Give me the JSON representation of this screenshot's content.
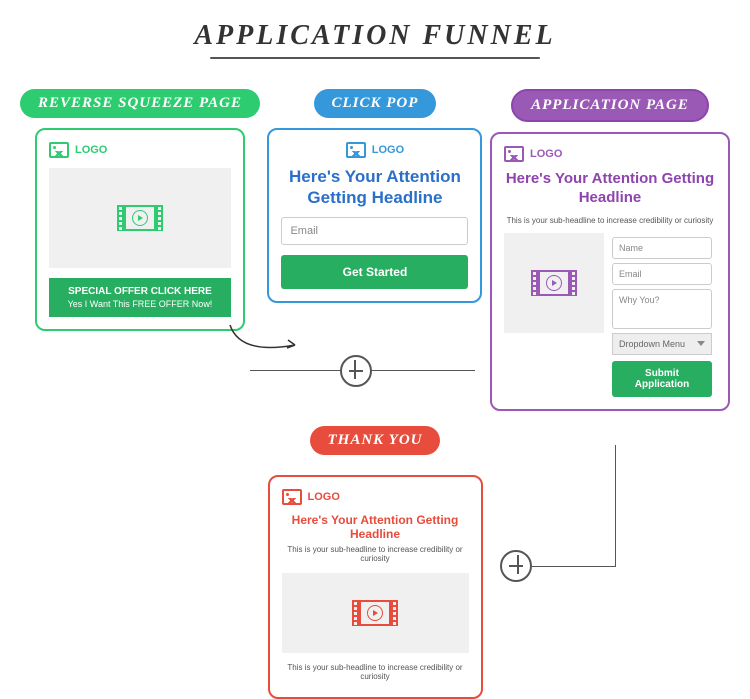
{
  "title": "APPLICATION FUNNEL",
  "pills": {
    "reverse_squeeze": "REVERSE SQUEEZE PAGE",
    "click_pop": "CLICK POP",
    "application_page": "APPLICATION PAGE",
    "thank_you": "THANK YOU"
  },
  "logo_text": "LOGO",
  "reverse_squeeze": {
    "button_main": "SPECIAL OFFER CLICK HERE",
    "button_sub": "Yes I Want This FREE OFFER Now!"
  },
  "click_pop": {
    "headline": "Here's Your Attention Getting Headline",
    "email_placeholder": "Email",
    "cta": "Get Started"
  },
  "application": {
    "headline": "Here's Your Attention Getting Headline",
    "subhead": "This is your sub-headline to increase credibility or curiosity",
    "name_placeholder": "Name",
    "email_placeholder": "Email",
    "why_placeholder": "Why You?",
    "dropdown": "Dropdown Menu",
    "submit": "Submit Application"
  },
  "thank_you": {
    "headline": "Here's Your Attention Getting Headline",
    "subhead": "This is your sub-headline to increase credibility or curiosity",
    "footer": "This is your sub-headline to increase credibility or curiosity"
  }
}
